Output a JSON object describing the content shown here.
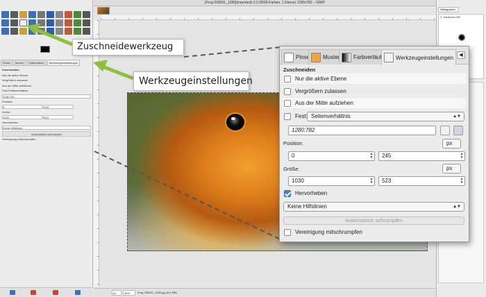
{
  "window": {
    "title": "[Frog-208591_1280](imported)-3.0 (RGB-Farben, 1 Ebene) 1280x782 – GIMP"
  },
  "annotations": {
    "crop_tool": "Zuschneidewerkzeug",
    "tool_options": "Werkzeugeinstellungen"
  },
  "toolbox_small": {
    "tabs": [
      "Pinsel",
      "Muster",
      "Farbverläufe",
      "Werkzeugeinstellungen"
    ],
    "title": "Zuschneiden",
    "only_active_layer": "Nur die aktive Ebene",
    "allow_growing": "Vergrößern zulassen",
    "expand_center": "Aus der Mitte aufziehen",
    "fixed": "Fest",
    "aspect": "Seitenverhältnis",
    "ratio": "1280:782",
    "position_label": "Position:",
    "pos_x": "0",
    "pos_y": "245",
    "size_label": "Größe:",
    "size_w": "1030",
    "size_h": "523",
    "highlight": "Hervorheben",
    "guides": "Keine Hilfslinien",
    "auto_shrink": "Automatisch schrumpfen",
    "shrink_merged": "Vereinigung mitschrumpfen"
  },
  "panel": {
    "tabs": [
      "Pinsel",
      "Muster",
      "Farbverläufe",
      "Werkzeugeinstellungen"
    ],
    "title": "Zuschneiden",
    "only_active_layer": "Nur die aktive Ebene",
    "allow_growing": "Vergrößern zulassen",
    "expand_center": "Aus der Mitte aufziehen",
    "fixed_label": "Fest:",
    "aspect_select": "Seitenverhältnis",
    "ratio": "1280:782",
    "position_label": "Position:",
    "pos_unit": "px",
    "pos_x": "0",
    "pos_y": "245",
    "size_label": "Größe:",
    "size_unit": "px",
    "size_w": "1030",
    "size_h": "523",
    "highlight": "Hervorheben",
    "highlight_checked": true,
    "guides_select": "Keine Hilfslinien",
    "auto_shrink": "Automatisch schrumpfen",
    "shrink_merged": "Vereinigung mitschrumpfen"
  },
  "status": {
    "unit": "px",
    "zoom": "66%",
    "file": "Frog-208591_1280.jpg (6,6 MB)"
  },
  "dock": {
    "tab": "Histogramm",
    "brush_name": "2. Hardness 050"
  },
  "colors": {
    "annotation_green": "#8fbf3f",
    "accent_blue": "#4a7fd0"
  }
}
